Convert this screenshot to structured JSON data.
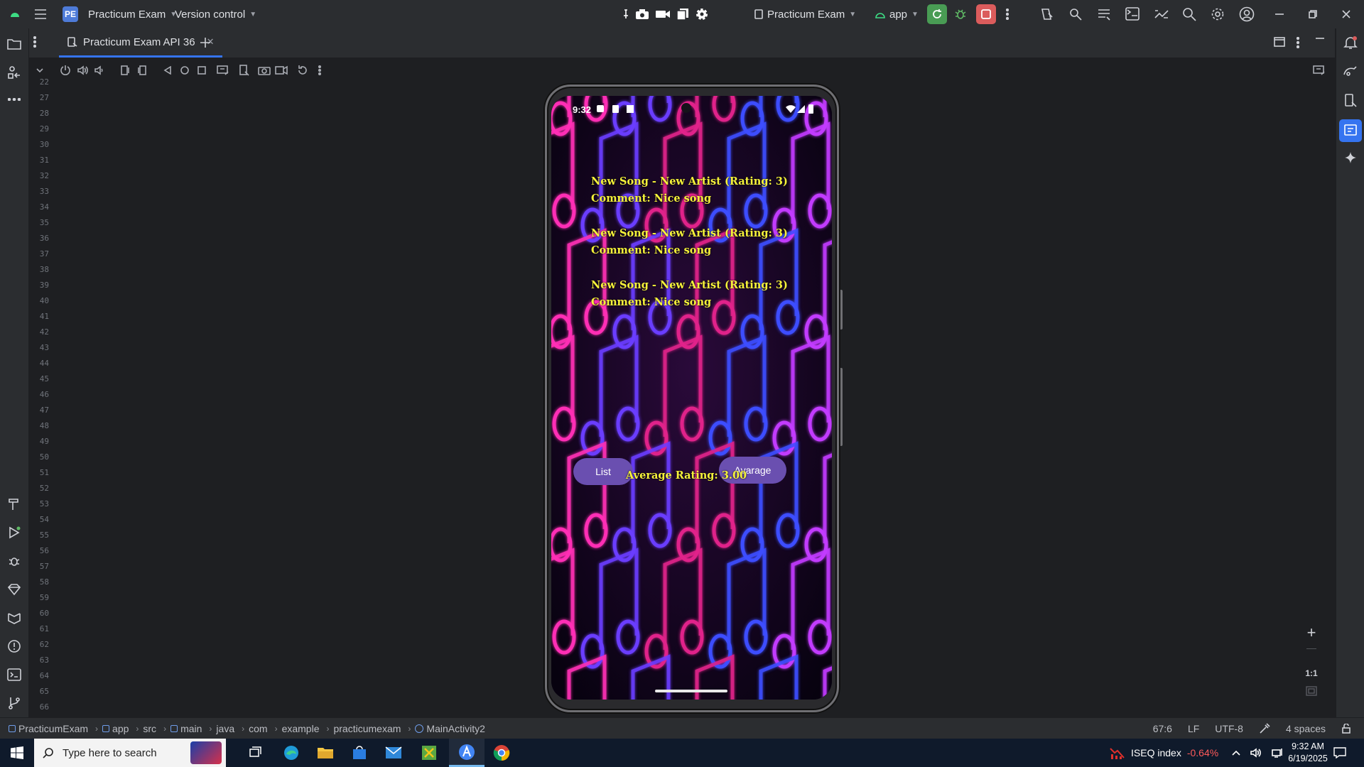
{
  "titlebar": {
    "project_badge": "PE",
    "project_name": "Practicum Exam",
    "vcs_label": "Version control",
    "run_config": "Practicum Exam",
    "module": "app",
    "colors": {
      "run": "#499c54",
      "stop": "#db5c5c",
      "badge": "#4e7bd8"
    }
  },
  "tabs": [
    {
      "label": "Practicum Exam API 36",
      "icon": "device-icon"
    }
  ],
  "gutter": {
    "lines": [
      "22",
      "27",
      "28",
      "29",
      "30",
      "31",
      "32",
      "33",
      "34",
      "35",
      "36",
      "37",
      "38",
      "39",
      "40",
      "41",
      "42",
      "43",
      "44",
      "45",
      "46",
      "47",
      "48",
      "49",
      "50",
      "51",
      "52",
      "53",
      "54",
      "55",
      "56",
      "57",
      "58",
      "59",
      "60",
      "61",
      "62",
      "63",
      "64",
      "65",
      "66"
    ]
  },
  "device": {
    "status": {
      "time": "9:32"
    },
    "songs": [
      {
        "line1": "New Song - New Artist (Rating: 3)",
        "line2": "Comment: Nice song"
      },
      {
        "line1": "New Song - New Artist (Rating: 3)",
        "line2": "Comment: Nice song"
      },
      {
        "line1": "New Song - New Artist (Rating: 3)",
        "line2": "Comment: Nice song"
      }
    ],
    "list_button": "List",
    "average_text": "Average Rating: 3.00",
    "average_button": "Avarage",
    "colors": {
      "text": "#f5f23a",
      "button": "#6a4fb0"
    }
  },
  "zoom": {
    "plus": "+",
    "minus": "—",
    "ratio": "1:1"
  },
  "statusbar": {
    "breadcrumbs": [
      "PracticumExam",
      "app",
      "src",
      "main",
      "java",
      "com",
      "example",
      "practicumexam",
      "MainActivity2"
    ],
    "position": "67:6",
    "line_ending": "LF",
    "encoding": "UTF-8",
    "indent": "4 spaces"
  },
  "taskbar": {
    "search_placeholder": "Type here to search",
    "stock_name": "ISEQ index",
    "stock_change": "-0.64%",
    "time": "9:32 AM",
    "date": "6/19/2025"
  }
}
